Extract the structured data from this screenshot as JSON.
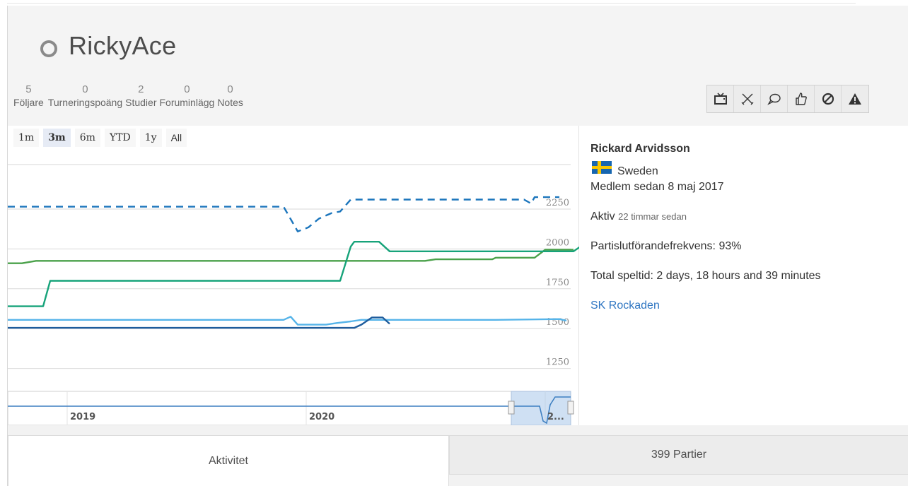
{
  "profile": {
    "username": "RickyAce",
    "status": "offline"
  },
  "stats": [
    {
      "count": "5",
      "label": "Följare"
    },
    {
      "count": "0",
      "label": "Turneringspoäng"
    },
    {
      "count": "2",
      "label": "Studier"
    },
    {
      "count": "0",
      "label": "Foruminlägg"
    },
    {
      "count": "0",
      "label": "Notes"
    }
  ],
  "actions": [
    {
      "icon": "tv-icon"
    },
    {
      "icon": "crossed-swords-icon"
    },
    {
      "icon": "speech-bubble-icon"
    },
    {
      "icon": "thumbs-up-icon"
    },
    {
      "icon": "block-icon"
    },
    {
      "icon": "warning-icon"
    }
  ],
  "range_selector": {
    "buttons": [
      "1m",
      "3m",
      "6m",
      "YTD",
      "1y",
      "All"
    ],
    "selected": "3m"
  },
  "chart_data": {
    "type": "line",
    "y_ticks": [
      2250,
      2000,
      1750,
      1500,
      1250
    ],
    "navigator_labels": [
      "2019",
      "2020",
      "2..."
    ],
    "grid": true,
    "colors": {
      "dashed_blue": "#1b75bc",
      "green": "#4aa14a",
      "teal": "#17a37a",
      "light_blue": "#56b4e9",
      "dark_blue": "#1e5c9c"
    },
    "series": [
      {
        "style": "dashed",
        "color": "#1b75bc",
        "points": [
          [
            0,
            2265
          ],
          [
            390,
            2265
          ],
          [
            410,
            2110
          ],
          [
            425,
            2135
          ],
          [
            440,
            2190
          ],
          [
            458,
            2225
          ],
          [
            470,
            2235
          ],
          [
            485,
            2310
          ],
          [
            730,
            2310
          ],
          [
            740,
            2285
          ],
          [
            745,
            2325
          ],
          [
            780,
            2325
          ]
        ]
      },
      {
        "style": "solid",
        "color": "#4aa14a",
        "points": [
          [
            0,
            1910
          ],
          [
            20,
            1910
          ],
          [
            40,
            1925
          ],
          [
            590,
            1925
          ],
          [
            605,
            1935
          ],
          [
            685,
            1935
          ],
          [
            690,
            1945
          ],
          [
            745,
            1945
          ],
          [
            760,
            1995
          ],
          [
            800,
            1995
          ]
        ]
      },
      {
        "style": "solid",
        "color": "#17a37a",
        "points": [
          [
            0,
            1640
          ],
          [
            50,
            1640
          ],
          [
            60,
            1800
          ],
          [
            470,
            1800
          ],
          [
            485,
            2015
          ],
          [
            490,
            2045
          ],
          [
            525,
            2045
          ],
          [
            540,
            1985
          ],
          [
            800,
            1985
          ],
          [
            810,
            2015
          ]
        ]
      },
      {
        "style": "solid",
        "color": "#56b4e9",
        "points": [
          [
            0,
            1555
          ],
          [
            390,
            1555
          ],
          [
            400,
            1575
          ],
          [
            410,
            1525
          ],
          [
            450,
            1525
          ],
          [
            465,
            1535
          ],
          [
            485,
            1545
          ],
          [
            500,
            1555
          ],
          [
            690,
            1555
          ],
          [
            780,
            1560
          ],
          [
            790,
            1550
          ]
        ]
      },
      {
        "style": "solid",
        "color": "#1e5c9c",
        "points": [
          [
            0,
            1505
          ],
          [
            490,
            1505
          ],
          [
            500,
            1525
          ],
          [
            515,
            1570
          ],
          [
            530,
            1570
          ],
          [
            540,
            1530
          ]
        ]
      }
    ]
  },
  "info": {
    "full_name": "Rickard Arvidsson",
    "country": "Sweden",
    "member_since": "Medlem sedan 8 maj 2017",
    "active_label": "Aktiv",
    "active_value": "22 timmar sedan",
    "completion_label": "Partislutförandefrekvens:",
    "completion_value": "93%",
    "playtime": "Total speltid: 2 days, 18 hours and 39 minutes",
    "club": "SK Rockaden"
  },
  "tabs": [
    {
      "label": "Aktivitet",
      "active": true
    },
    {
      "label": "399 Partier",
      "active": false
    }
  ]
}
